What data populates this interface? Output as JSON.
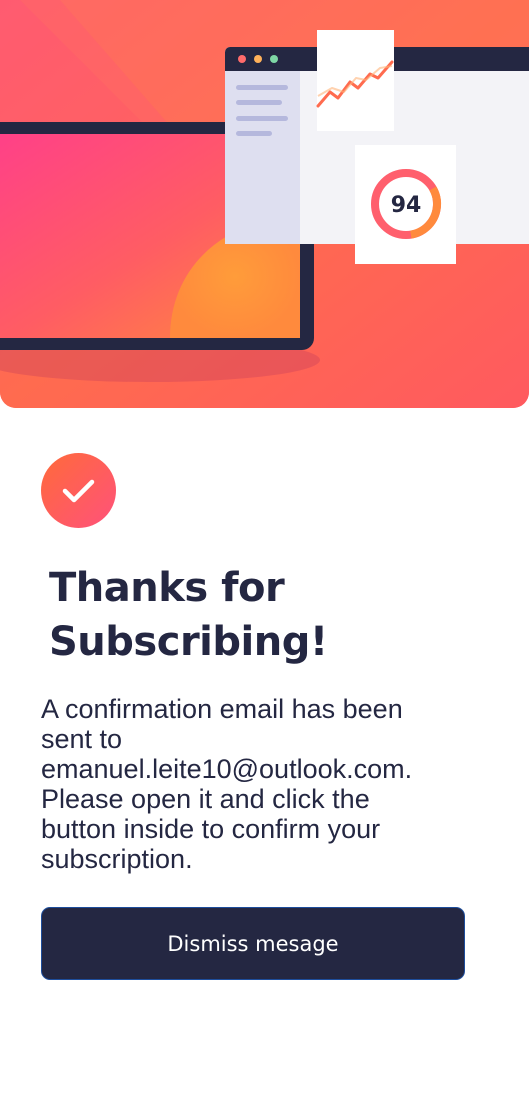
{
  "hero": {
    "score": "94",
    "illustration_icon": "analytics-dashboard-illustration"
  },
  "badge": {
    "icon": "checkmark-icon"
  },
  "content": {
    "title_line1": "Thanks for",
    "title_line2": "Subscribing!",
    "message_line1": "A confirmation email has been",
    "message_line2": "sent to",
    "message_line3": "emanuel.leite10@outlook.com.",
    "message_line4": "Please open it and click the",
    "message_line5": "button inside to confirm your",
    "message_line6": "subscription."
  },
  "actions": {
    "dismiss_label": "Dismiss mesage"
  },
  "colors": {
    "dark_navy": "#242742",
    "tomato": "#ff6155",
    "accent_pink": "#ff527b",
    "accent_orange": "#ff6a3a"
  }
}
